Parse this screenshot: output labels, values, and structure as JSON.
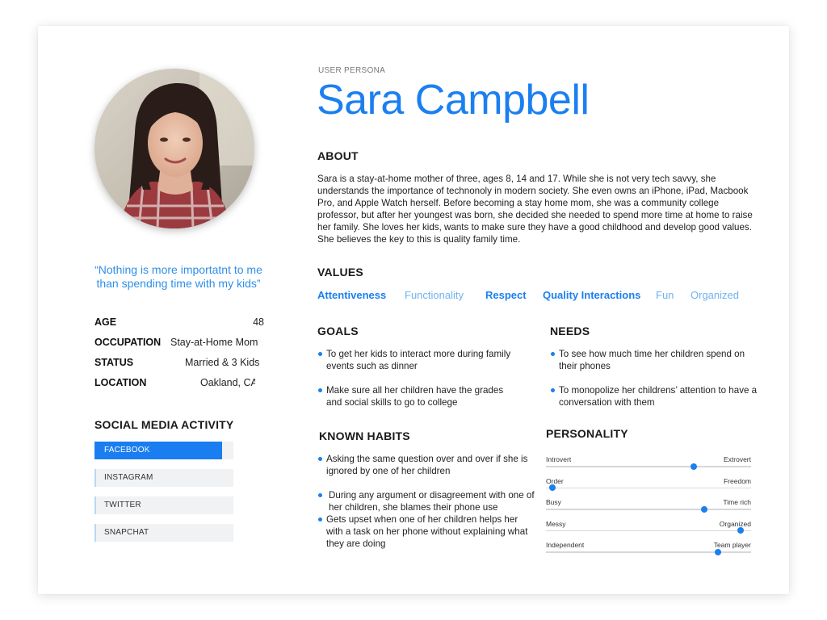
{
  "persona": {
    "tag": "USER PERSONA",
    "name": "Sara Campbell",
    "quote": "“Nothing is more importatnt to me than spending time with my kids”"
  },
  "facts": [
    {
      "label": "AGE",
      "value": "48"
    },
    {
      "label": "OCCUPATION",
      "value": "Stay-at-Home Mom"
    },
    {
      "label": "STATUS",
      "value": "Married & 3 Kids"
    },
    {
      "label": "LOCATION",
      "value": "Oakland, CA"
    }
  ],
  "social": {
    "title": "SOCIAL MEDIA ACTIVITY",
    "items": [
      {
        "label": "FACEBOOK",
        "level": 0.92
      },
      {
        "label": "INSTAGRAM",
        "level": 0.0
      },
      {
        "label": "TWITTER",
        "level": 0.0
      },
      {
        "label": "SNAPCHAT",
        "level": 0.0
      }
    ]
  },
  "about": {
    "title": "ABOUT",
    "text": "Sara is a stay-at-home mother of three, ages 8, 14 and 17. While she is not very tech savvy, she understands the importance of technonoly in modern society. She even owns an iPhone, iPad, Macbook Pro, and Apple Watch herself. Before becoming a stay home mom, she was a community college professor, but after her youngest was born, she decided she needed to spend more time at home to raise her family. She loves her kids, wants to make sure they have a good childhood and develop good values. She believes the key to this is quality family time."
  },
  "values": {
    "title": "VALUES",
    "items": [
      {
        "label": "Attentiveness",
        "emphasis": "strong"
      },
      {
        "label": "Functionality",
        "emphasis": "light"
      },
      {
        "label": "Respect",
        "emphasis": "strong"
      },
      {
        "label": "Quality Interactions",
        "emphasis": "strong"
      },
      {
        "label": "Fun",
        "emphasis": "light"
      },
      {
        "label": "Organized",
        "emphasis": "light"
      }
    ]
  },
  "goals": {
    "title": "GOALS",
    "items": [
      "To get her kids to interact more during family events such as dinner",
      "Make sure all her children have the grades and social skills to go to college"
    ]
  },
  "needs": {
    "title": "NEEDS",
    "items": [
      "To see how much time her children spend on their phones",
      "To monopolize her childrens’ attention to have a conversation with them"
    ]
  },
  "habits": {
    "title": "KNOWN HABITS",
    "items": [
      "Asking the same question over and over if she is ignored by one of her children",
      "During any argument or disagreement with one of her children, she blames their phone use",
      "Gets upset when one of her children helps her with a task on her phone without explaining what they are doing"
    ]
  },
  "personality": {
    "title": "PERSONALITY",
    "traits": [
      {
        "left": "Introvert",
        "right": "Extrovert",
        "value": 0.72
      },
      {
        "left": "Order",
        "right": "Freedom",
        "value": 0.03
      },
      {
        "left": "Busy",
        "right": "Time rich",
        "value": 0.77
      },
      {
        "left": "Messy",
        "right": "Organized",
        "value": 0.95
      },
      {
        "left": "Independent",
        "right": "Team player",
        "value": 0.84
      }
    ]
  },
  "colors": {
    "accent": "#1b7ff0",
    "accent_light": "#6fb2ef",
    "quote": "#2f8fe8"
  }
}
